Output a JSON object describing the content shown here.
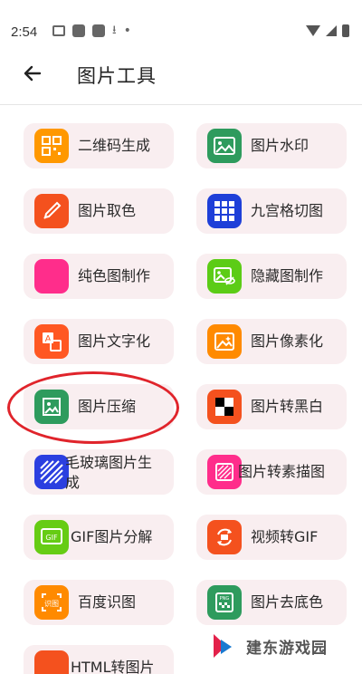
{
  "status": {
    "time": "2:54"
  },
  "header": {
    "title": "图片工具"
  },
  "tools": [
    {
      "label": "二维码生成",
      "icon": "qr-code-icon",
      "color": "#ff9800"
    },
    {
      "label": "图片水印",
      "icon": "image-watermark-icon",
      "color": "#2e9b5d"
    },
    {
      "label": "图片取色",
      "icon": "eyedropper-icon",
      "color": "#f4511e"
    },
    {
      "label": "九宫格切图",
      "icon": "grid-nine-icon",
      "color": "#1e3fd8"
    },
    {
      "label": "纯色图制作",
      "icon": "solid-color-icon",
      "color": "#ff2d8b"
    },
    {
      "label": "隐藏图制作",
      "icon": "hidden-image-icon",
      "color": "#5ccc16"
    },
    {
      "label": "图片文字化",
      "icon": "text-image-icon",
      "color": "#ff5722"
    },
    {
      "label": "图片像素化",
      "icon": "pixelate-icon",
      "color": "#ff8a00"
    },
    {
      "label": "图片压缩",
      "icon": "compress-image-icon",
      "color": "#2e9b5d"
    },
    {
      "label": "图片转黑白",
      "icon": "black-white-icon",
      "color": "#f4511e"
    },
    {
      "label": "毛玻璃图片生成",
      "icon": "frosted-glass-icon",
      "color": "#2b3fe0"
    },
    {
      "label": "图片转素描图",
      "icon": "sketch-icon",
      "color": "#ff2d8b"
    },
    {
      "label": "GIF图片分解",
      "icon": "gif-split-icon",
      "color": "#66cc14"
    },
    {
      "label": "视频转GIF",
      "icon": "video-to-gif-icon",
      "color": "#f4511e"
    },
    {
      "label": "百度识图",
      "icon": "image-recognize-icon",
      "color": "#ff8a00"
    },
    {
      "label": "图片去底色",
      "icon": "remove-background-icon",
      "color": "#2e9b5d"
    },
    {
      "label": "HTML转图片",
      "icon": "html-to-image-icon",
      "color": "#f4511e"
    }
  ],
  "watermark": {
    "text": "建东游戏园"
  }
}
